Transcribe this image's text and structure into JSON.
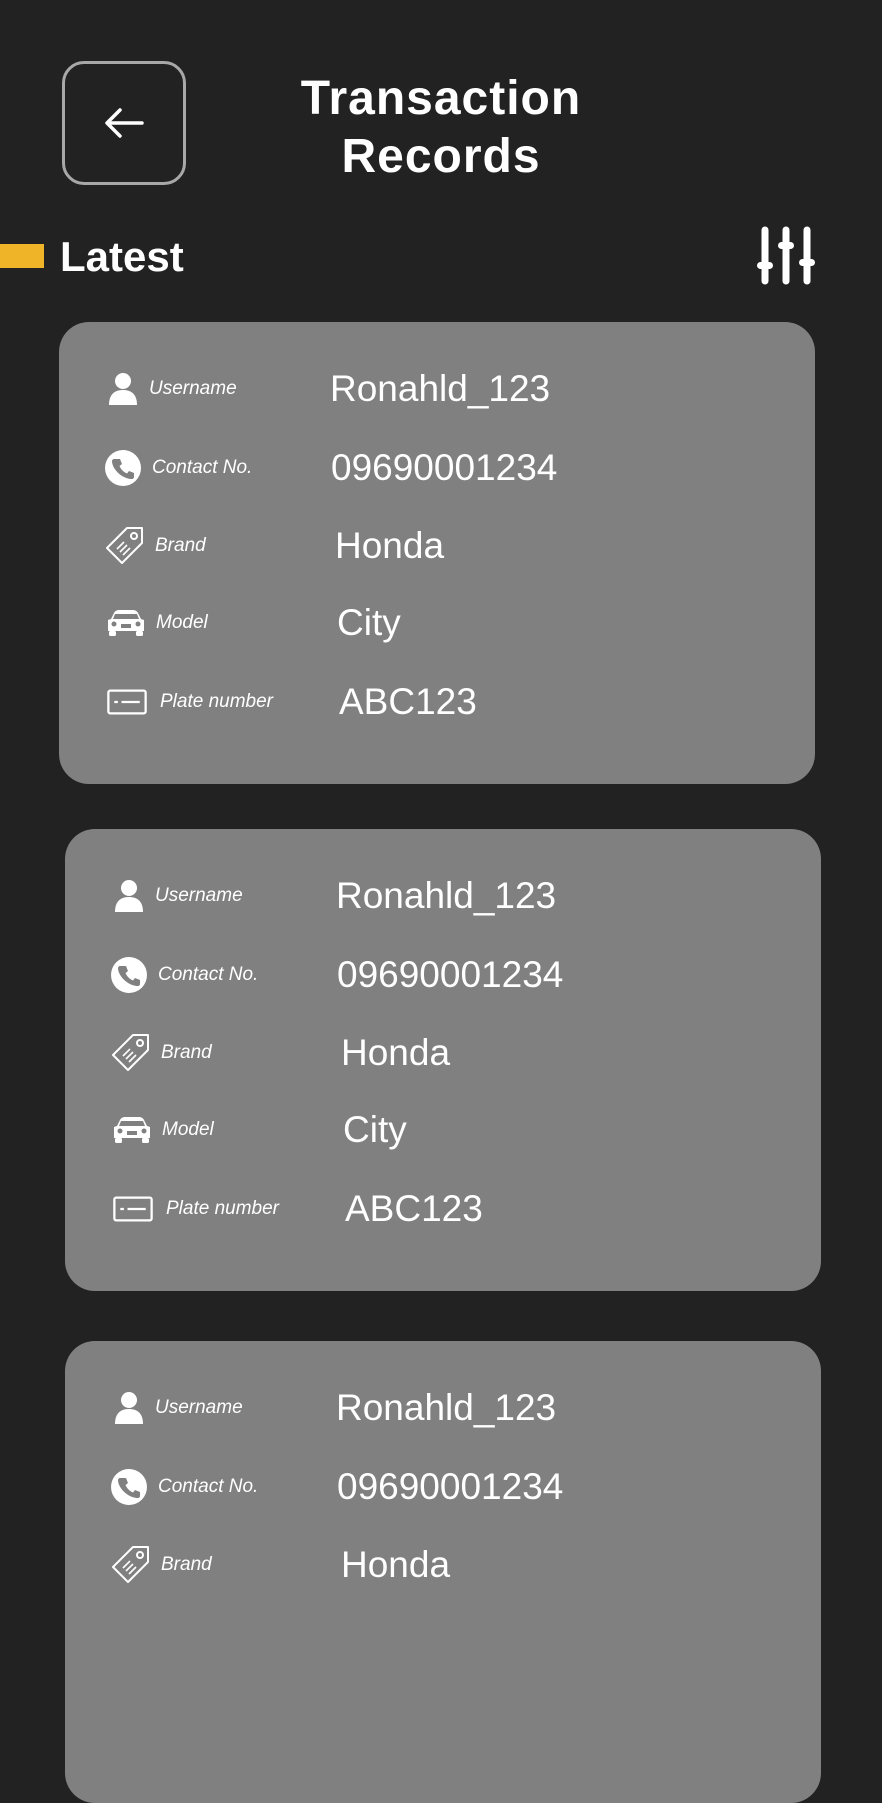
{
  "header": {
    "title_line1": "Transaction",
    "title_line2": "Records"
  },
  "section": {
    "title": "Latest",
    "accent_color": "#F0B429"
  },
  "labels": {
    "username": "Username",
    "contact": "Contact No.",
    "brand": "Brand",
    "model": "Model",
    "plate": "Plate number"
  },
  "records": [
    {
      "username": "Ronahld_123",
      "contact": "09690001234",
      "brand": "Honda",
      "model": "City",
      "plate": "ABC123"
    },
    {
      "username": "Ronahld_123",
      "contact": "09690001234",
      "brand": "Honda",
      "model": "City",
      "plate": "ABC123"
    },
    {
      "username": "Ronahld_123",
      "contact": "09690001234",
      "brand": "Honda"
    }
  ],
  "icons": {
    "back": "arrow-left-icon",
    "filter": "sliders-icon",
    "username": "user-icon",
    "contact": "phone-icon",
    "brand": "tag-icon",
    "model": "car-icon",
    "plate": "license-plate-icon"
  },
  "colors": {
    "background": "#222222",
    "card": "#808080",
    "text": "#FFFFFF"
  }
}
